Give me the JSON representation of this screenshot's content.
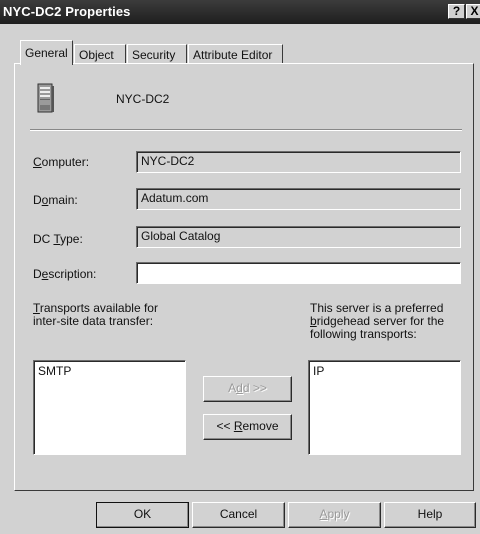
{
  "window": {
    "title": "NYC-DC2 Properties",
    "help_glyph": "?",
    "close_glyph": "X"
  },
  "tabs": [
    {
      "label": "General"
    },
    {
      "label": "Object"
    },
    {
      "label": "Security"
    },
    {
      "label": "Attribute Editor"
    }
  ],
  "header": {
    "server_name": "NYC-DC2",
    "icon": "server-icon"
  },
  "fields": {
    "computer": {
      "label_pre": "",
      "label_ul": "C",
      "label_post": "omputer:",
      "value": "NYC-DC2"
    },
    "domain": {
      "label_pre": "D",
      "label_ul": "o",
      "label_post": "main:",
      "value": "Adatum.com"
    },
    "dc_type": {
      "label_pre": "DC ",
      "label_ul": "T",
      "label_post": "ype:",
      "value": "Global Catalog"
    },
    "description": {
      "label_pre": "D",
      "label_ul": "e",
      "label_post": "scription:",
      "value": ""
    }
  },
  "transports": {
    "available_label_ul": "T",
    "available_label_l1": "ransports available for",
    "available_label_l2": "inter-site data transfer:",
    "available_items": [
      "SMTP"
    ],
    "preferred_label_l1": "This server is a preferred",
    "preferred_label_l2_ul": "b",
    "preferred_label_l2": "ridgehead server for the",
    "preferred_label_l3": "following transports:",
    "preferred_items": [
      "IP"
    ],
    "add_pre": "A",
    "add_ul": "d",
    "add_post": "d >>",
    "remove_pre": "<< ",
    "remove_ul": "R",
    "remove_post": "emove"
  },
  "footer": {
    "ok": "OK",
    "cancel": "Cancel",
    "apply_ul": "A",
    "apply_post": "pply",
    "help": "Help"
  },
  "colors": {
    "titlebar": "#2a2a2a",
    "dialog_bg": "#d2d2d2"
  }
}
